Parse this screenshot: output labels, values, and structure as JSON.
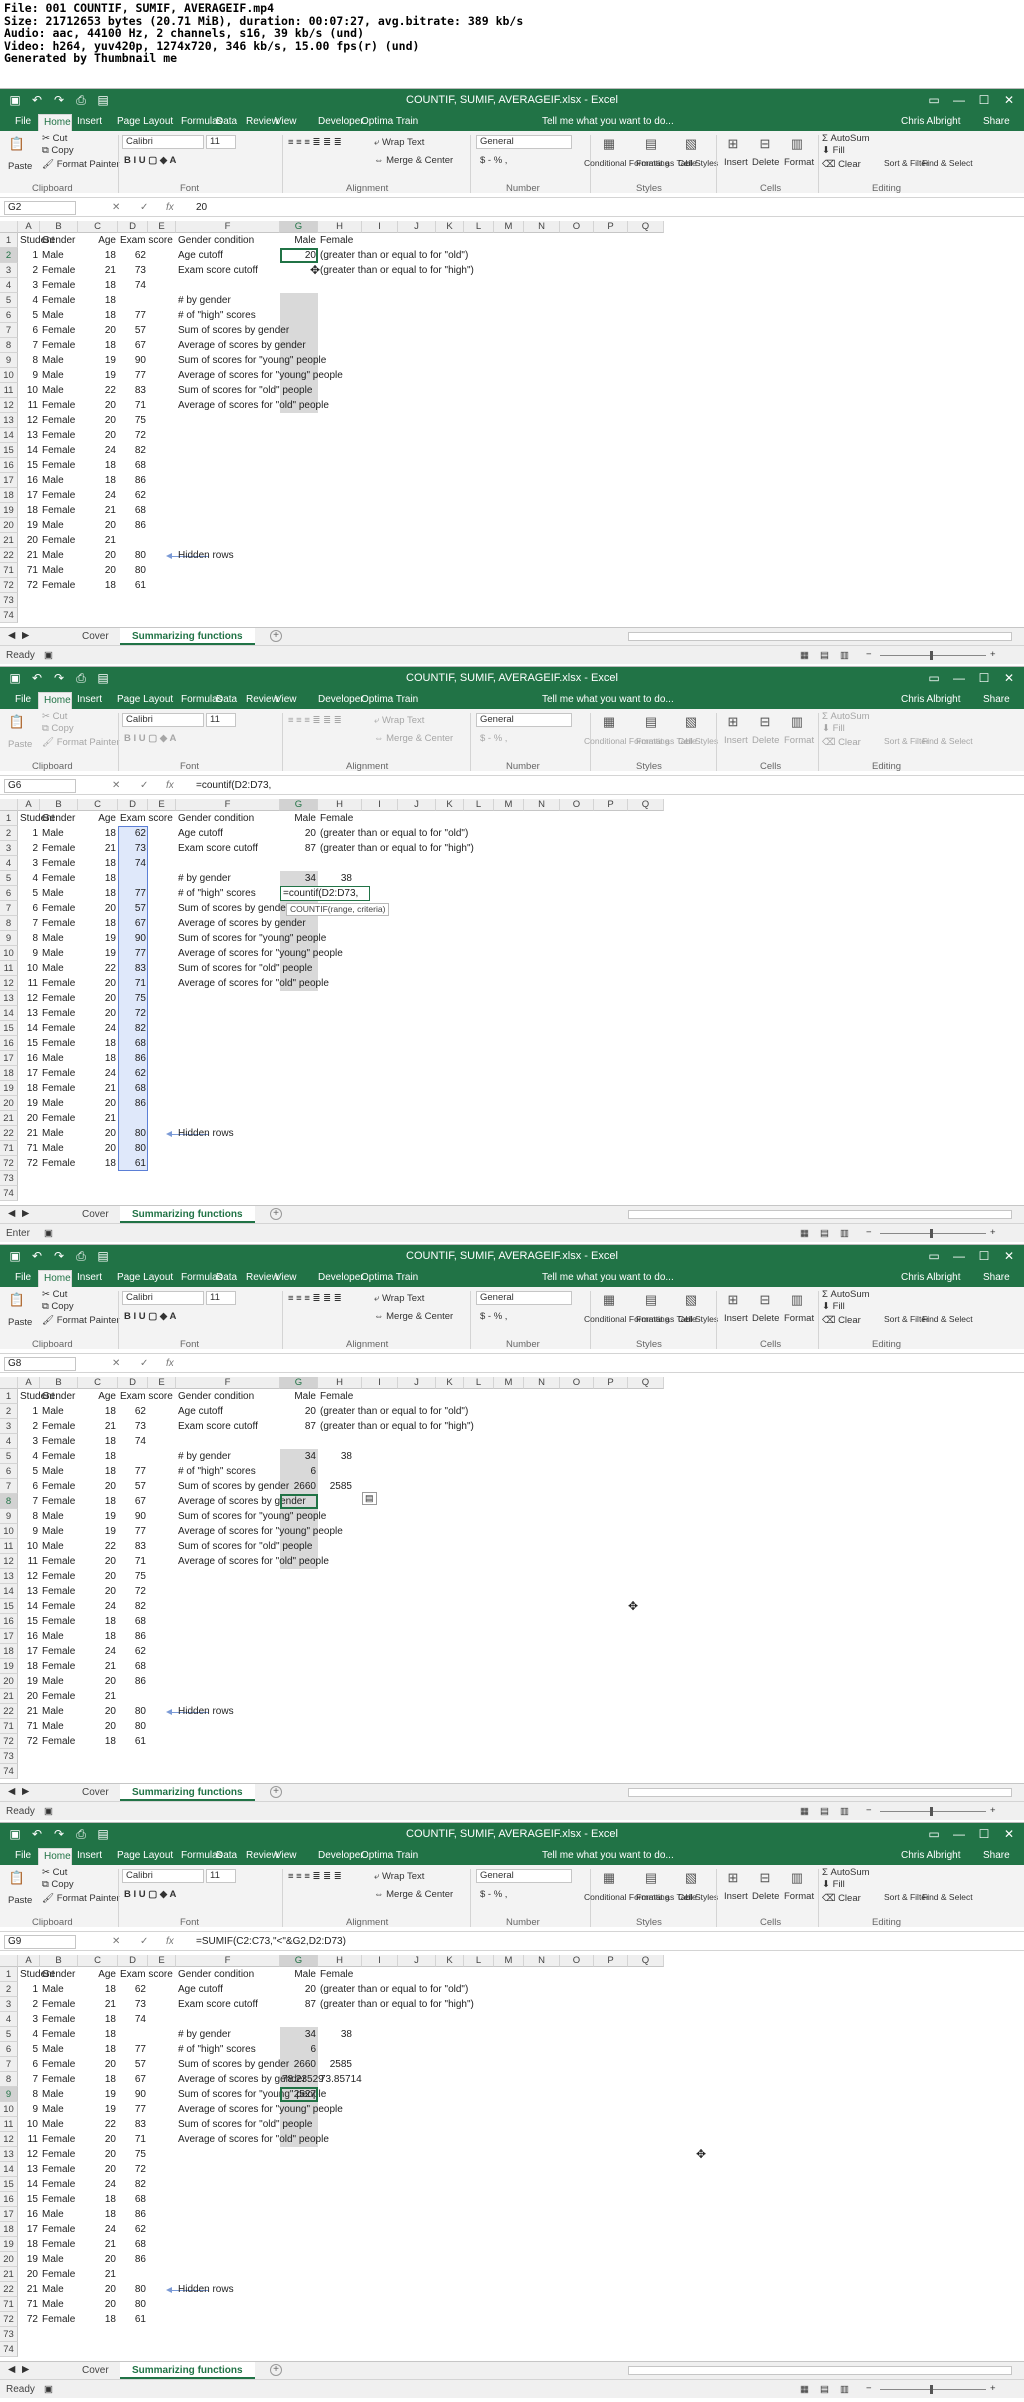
{
  "thumb_header": [
    "File: 001 COUNTIF, SUMIF, AVERAGEIF.mp4",
    "Size: 21712653 bytes (20.71 MiB), duration: 00:07:27, avg.bitrate: 389 kb/s",
    "Audio: aac, 44100 Hz, 2 channels, s16, 39 kb/s (und)",
    "Video: h264, yuv420p, 1274x720, 346 kb/s, 15.00 fps(r) (und)",
    "Generated by Thumbnail me"
  ],
  "app": {
    "title": "COUNTIF, SUMIF, AVERAGEIF.xlsx - Excel",
    "user": "Chris Albright",
    "share": "Share",
    "tell_me": "Tell me what you want to do...",
    "tabs": [
      "File",
      "Home",
      "Insert",
      "Page Layout",
      "Formulas",
      "Data",
      "Review",
      "View",
      "Developer",
      "Optima Train"
    ],
    "clipboard": {
      "paste": "Paste",
      "cut": "Cut",
      "copy": "Copy",
      "format_painter": "Format Painter",
      "label": "Clipboard"
    },
    "font": {
      "name": "Calibri",
      "size": "11",
      "label": "Font"
    },
    "alignment": {
      "wrap": "Wrap Text",
      "merge": "Merge & Center",
      "label": "Alignment"
    },
    "number": {
      "format": "General",
      "symbols": "$ - % ,",
      "label": "Number"
    },
    "styles": {
      "cond_fmt": "Conditional Formatting",
      "fmt_table": "Format as Table",
      "cell_styles": "Cell Styles",
      "label": "Styles"
    },
    "cells": {
      "insert": "Insert",
      "delete": "Delete",
      "format": "Format",
      "label": "Cells"
    },
    "editing": {
      "autosum": "AutoSum",
      "fill": "Fill",
      "clear": "Clear",
      "sort": "Sort & Filter",
      "find": "Find & Select",
      "label": "Editing"
    },
    "columns": [
      "A",
      "B",
      "C",
      "D",
      "E",
      "F",
      "G",
      "H",
      "I",
      "J",
      "K",
      "L",
      "M",
      "N",
      "O",
      "P",
      "Q"
    ],
    "sheet_tabs": [
      "Cover",
      "Summarizing functions"
    ],
    "fx": "fx",
    "status_icon": "record-macro-icon"
  },
  "sheet": {
    "header": [
      "Student",
      "Gender",
      "Age",
      "Exam score"
    ],
    "students": [
      [
        "1",
        "Male",
        "18",
        "62"
      ],
      [
        "2",
        "Female",
        "21",
        "73"
      ],
      [
        "3",
        "Female",
        "18",
        "74"
      ],
      [
        "4",
        "Female",
        "18",
        ""
      ],
      [
        "5",
        "Male",
        "18",
        "77"
      ],
      [
        "6",
        "Female",
        "20",
        "57"
      ],
      [
        "7",
        "Female",
        "18",
        "67"
      ],
      [
        "8",
        "Male",
        "19",
        "90"
      ],
      [
        "9",
        "Male",
        "19",
        "77"
      ],
      [
        "10",
        "Male",
        "22",
        "83"
      ],
      [
        "11",
        "Female",
        "20",
        "71"
      ],
      [
        "12",
        "Female",
        "20",
        "75"
      ],
      [
        "13",
        "Female",
        "20",
        "72"
      ],
      [
        "14",
        "Female",
        "24",
        "82"
      ],
      [
        "15",
        "Female",
        "18",
        "68"
      ],
      [
        "16",
        "Male",
        "18",
        "86"
      ],
      [
        "17",
        "Female",
        "24",
        "62"
      ],
      [
        "18",
        "Female",
        "21",
        "68"
      ],
      [
        "19",
        "Male",
        "20",
        "86"
      ],
      [
        "20",
        "Female",
        "21",
        ""
      ],
      [
        "21",
        "Male",
        "20",
        "80"
      ],
      [
        "71",
        "Male",
        "20",
        "80"
      ],
      [
        "72",
        "Female",
        "18",
        "61"
      ]
    ],
    "row_numbers": [
      "1",
      "2",
      "3",
      "4",
      "5",
      "6",
      "7",
      "8",
      "9",
      "10",
      "11",
      "12",
      "13",
      "14",
      "15",
      "16",
      "17",
      "18",
      "19",
      "20",
      "21",
      "22",
      "71",
      "72",
      "73",
      "74"
    ],
    "f_labels": [
      "Gender condition",
      "Age cutoff",
      "Exam score cutoff",
      "",
      "# by gender",
      "# of \"high\" scores",
      "Sum of scores by gender",
      "Average of scores by gender",
      "Sum of scores for \"young\" people",
      "Average of scores for \"young\" people",
      "Sum of scores for \"old\" people",
      "Average of scores for \"old\" people"
    ],
    "g_head": "Male",
    "h_head": "Female",
    "notes": {
      "old": "(greater than or equal to for \"old\")",
      "high": "(greater than or equal to for \"high\")"
    },
    "hidden_rows": "Hidden rows"
  },
  "frames": [
    {
      "name_box": "G2",
      "formula": "20",
      "status": "Ready",
      "age_cutoff": "20",
      "score_cutoff": "",
      "by_gender": [
        "",
        ""
      ],
      "high": "",
      "sum_gender": [
        "",
        ""
      ],
      "avg_gender": [
        "",
        ""
      ],
      "sum_young": "",
      "tooltip": ""
    },
    {
      "name_box": "G6",
      "formula": "=countif(D2:D73,",
      "status": "Enter",
      "age_cutoff": "20",
      "score_cutoff": "87",
      "by_gender": [
        "34",
        "38"
      ],
      "high": "=countif(D2:D73,",
      "sum_gender": [
        "",
        ""
      ],
      "avg_gender": [
        "",
        ""
      ],
      "sum_young": "",
      "tooltip": "COUNTIF(range, criteria)"
    },
    {
      "name_box": "G8",
      "formula": "",
      "status": "Ready",
      "age_cutoff": "20",
      "score_cutoff": "87",
      "by_gender": [
        "34",
        "38"
      ],
      "high": "6",
      "sum_gender": [
        "2660",
        "2585"
      ],
      "avg_gender": [
        "",
        ""
      ],
      "sum_young": "",
      "tooltip": ""
    },
    {
      "name_box": "G9",
      "formula": "=SUMIF(C2:C73,\"<\"&G2,D2:D73)",
      "status": "Ready",
      "age_cutoff": "20",
      "score_cutoff": "87",
      "by_gender": [
        "34",
        "38"
      ],
      "high": "6",
      "sum_gender": [
        "2660",
        "2585"
      ],
      "avg_gender": [
        "78.23529",
        "73.85714"
      ],
      "sum_young": "2527",
      "tooltip": ""
    }
  ]
}
